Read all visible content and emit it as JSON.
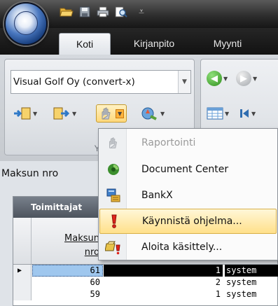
{
  "window": {
    "qat_icons": [
      "folder-open-icon",
      "save-icon",
      "print-icon",
      "print-preview-icon"
    ]
  },
  "tabs": [
    {
      "label": "Koti",
      "active": true
    },
    {
      "label": "Kirjanpito",
      "active": false
    },
    {
      "label": "Myynti",
      "active": false
    }
  ],
  "ribbon": {
    "company_combo_value": "Visual Golf Oy (convert-x)",
    "group1_label": "Yri"
  },
  "field": {
    "label": "Maksun nro"
  },
  "panel": {
    "title": "Toimittajat"
  },
  "grid": {
    "header_line1": "Maksun",
    "header_line2": "nro",
    "current_marker": "▶",
    "rows": [
      {
        "nro": "61",
        "count": "1",
        "user": "system",
        "current": true
      },
      {
        "nro": "60",
        "count": "2",
        "user": "system",
        "current": false
      },
      {
        "nro": "59",
        "count": "1",
        "user": "system",
        "current": false
      }
    ]
  },
  "menu": {
    "items": [
      {
        "label": "Raportointi",
        "icon": "report-icon",
        "enabled": false
      },
      {
        "label": "Document Center",
        "icon": "document-center-icon",
        "enabled": true
      },
      {
        "label": "BankX",
        "icon": "bank-icon",
        "enabled": true
      },
      {
        "label": "Käynnistä ohjelma...",
        "icon": "exclamation-icon",
        "enabled": true,
        "highlighted": true
      },
      {
        "label": "Aloita käsittely...",
        "icon": "start-processing-icon",
        "enabled": true
      }
    ]
  },
  "colors": {
    "highlight": "#ffe08a",
    "selection": "#9fc7ee",
    "titlebar": "#2e2e2e"
  }
}
